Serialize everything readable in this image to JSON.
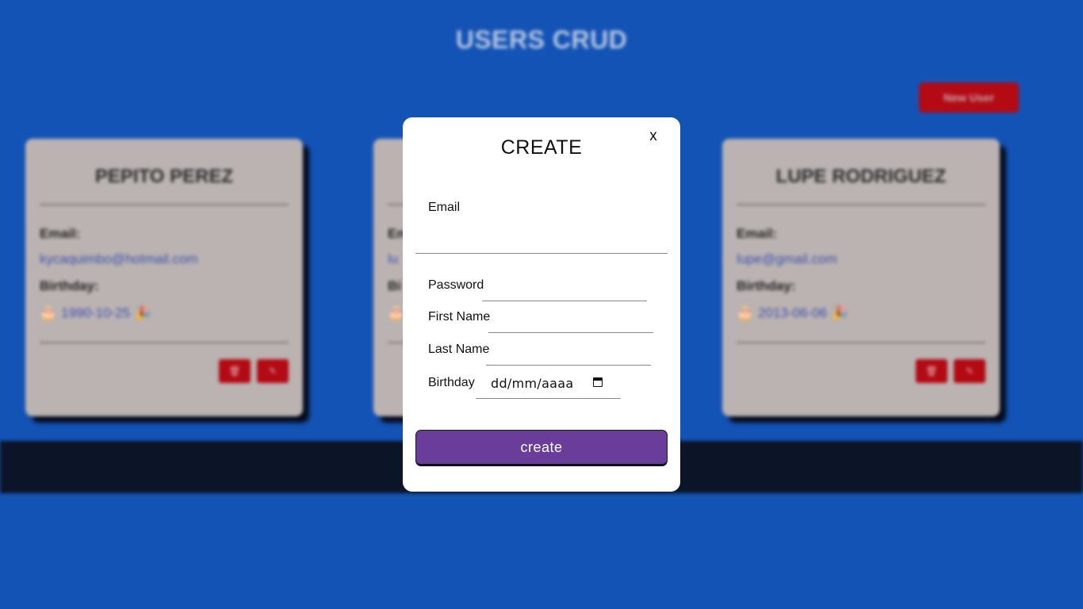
{
  "app": {
    "title": "USERS CRUD",
    "new_user_label": "New User"
  },
  "users": [
    {
      "name": "PEPITO PEREZ",
      "email_label": "Email:",
      "email": "kycaquimbo@hotmail.com",
      "birthday_label": "Birthday:",
      "birthday": "1990-10-25",
      "cake_emoji": "🎂",
      "party_emoji": "🎉",
      "delete_icon": "trash-icon",
      "edit_icon": "pencil-icon"
    },
    {
      "name": "",
      "email_label": "Em",
      "email": "lu",
      "birthday_label": "Bi",
      "birthday": "",
      "cake_emoji": "🎂",
      "party_emoji": "",
      "delete_icon": "trash-icon",
      "edit_icon": "pencil-icon"
    },
    {
      "name": "LUPE RODRIGUEZ",
      "email_label": "Email:",
      "email": "lupe@gmail.com",
      "birthday_label": "Birthday:",
      "birthday": "2013-06-06",
      "cake_emoji": "🎂",
      "party_emoji": "🎉",
      "delete_icon": "trash-icon",
      "edit_icon": "pencil-icon"
    }
  ],
  "modal": {
    "title": "CREATE",
    "close_label": "x",
    "fields": {
      "email": {
        "label": "Email",
        "value": ""
      },
      "password": {
        "label": "Password",
        "value": ""
      },
      "first_name": {
        "label": "First Name",
        "value": ""
      },
      "last_name": {
        "label": "Last Name",
        "value": ""
      },
      "birthday": {
        "label": "Birthday",
        "value": "dd/mm/aaaa",
        "icon": "calendar-icon"
      }
    },
    "submit_label": "create"
  },
  "colors": {
    "page_background": "#1453b6",
    "card_background": "#bab3b1",
    "danger": "#b30a14",
    "submit": "#6a3d9a",
    "footer": "#0b1527"
  }
}
